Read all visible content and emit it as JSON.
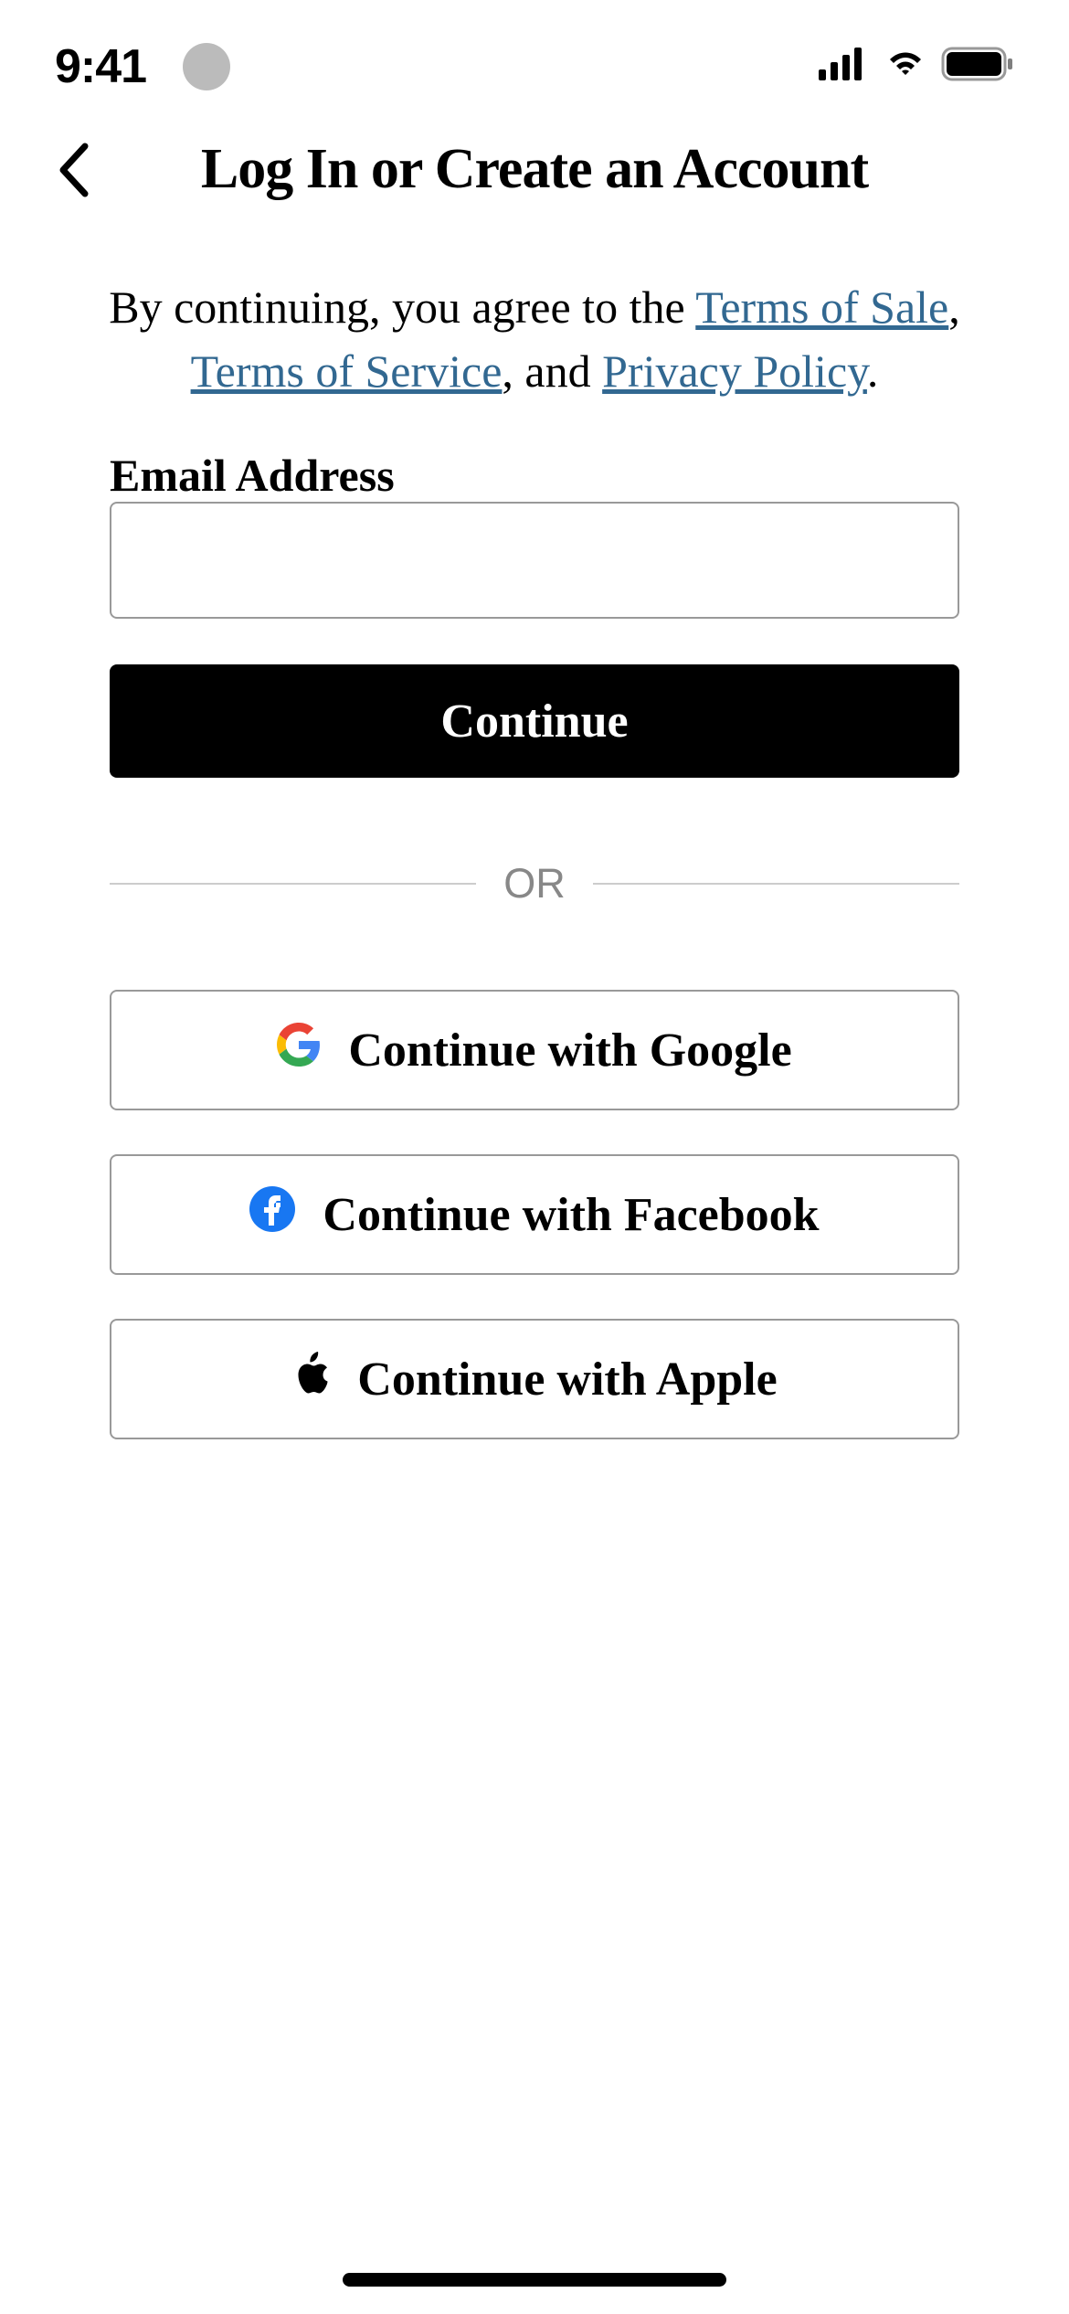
{
  "statusBar": {
    "time": "9:41"
  },
  "header": {
    "title": "Log In or Create an Account"
  },
  "consent": {
    "prefix": "By continuing, you agree to the ",
    "termsOfSale": "Terms of Sale",
    "separator1": ", ",
    "termsOfService": "Terms of Service",
    "separator2": ", and ",
    "privacyPolicy": "Privacy Policy",
    "suffix": "."
  },
  "form": {
    "emailLabel": "Email Address",
    "emailValue": "",
    "continueButton": "Continue",
    "dividerText": "OR",
    "googleButton": "Continue with Google",
    "facebookButton": "Continue with Facebook",
    "appleButton": "Continue with Apple"
  }
}
